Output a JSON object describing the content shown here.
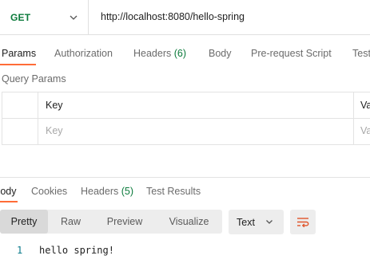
{
  "request": {
    "method": "GET",
    "url": "http://localhost:8080/hello-spring"
  },
  "request_tabs": [
    {
      "label": "Params",
      "count": ""
    },
    {
      "label": "Authorization",
      "count": ""
    },
    {
      "label": "Headers",
      "count": "(6)"
    },
    {
      "label": "Body",
      "count": ""
    },
    {
      "label": "Pre-request Script",
      "count": ""
    },
    {
      "label": "Test",
      "count": ""
    }
  ],
  "query_params": {
    "title": "Query Params",
    "columns": [
      "Key",
      "Va"
    ],
    "placeholders": [
      "Key",
      "Va"
    ]
  },
  "response_tabs": [
    {
      "label": "Body",
      "count": ""
    },
    {
      "label": "Cookies",
      "count": ""
    },
    {
      "label": "Headers",
      "count": "(5)"
    },
    {
      "label": "Test Results",
      "count": ""
    }
  ],
  "view_modes": [
    "Pretty",
    "Raw",
    "Preview",
    "Visualize"
  ],
  "active_view_mode": "Pretty",
  "format": "Text",
  "response_body": {
    "line_number": "1",
    "text": "hello spring!"
  },
  "colors": {
    "accent": "#ff6c37",
    "method": "#0b7a3b",
    "count": "#0b7a3b"
  },
  "icons": {
    "method_dropdown": "chevron-down-icon",
    "format_dropdown": "chevron-down-icon",
    "wrap": "word-wrap-icon"
  }
}
